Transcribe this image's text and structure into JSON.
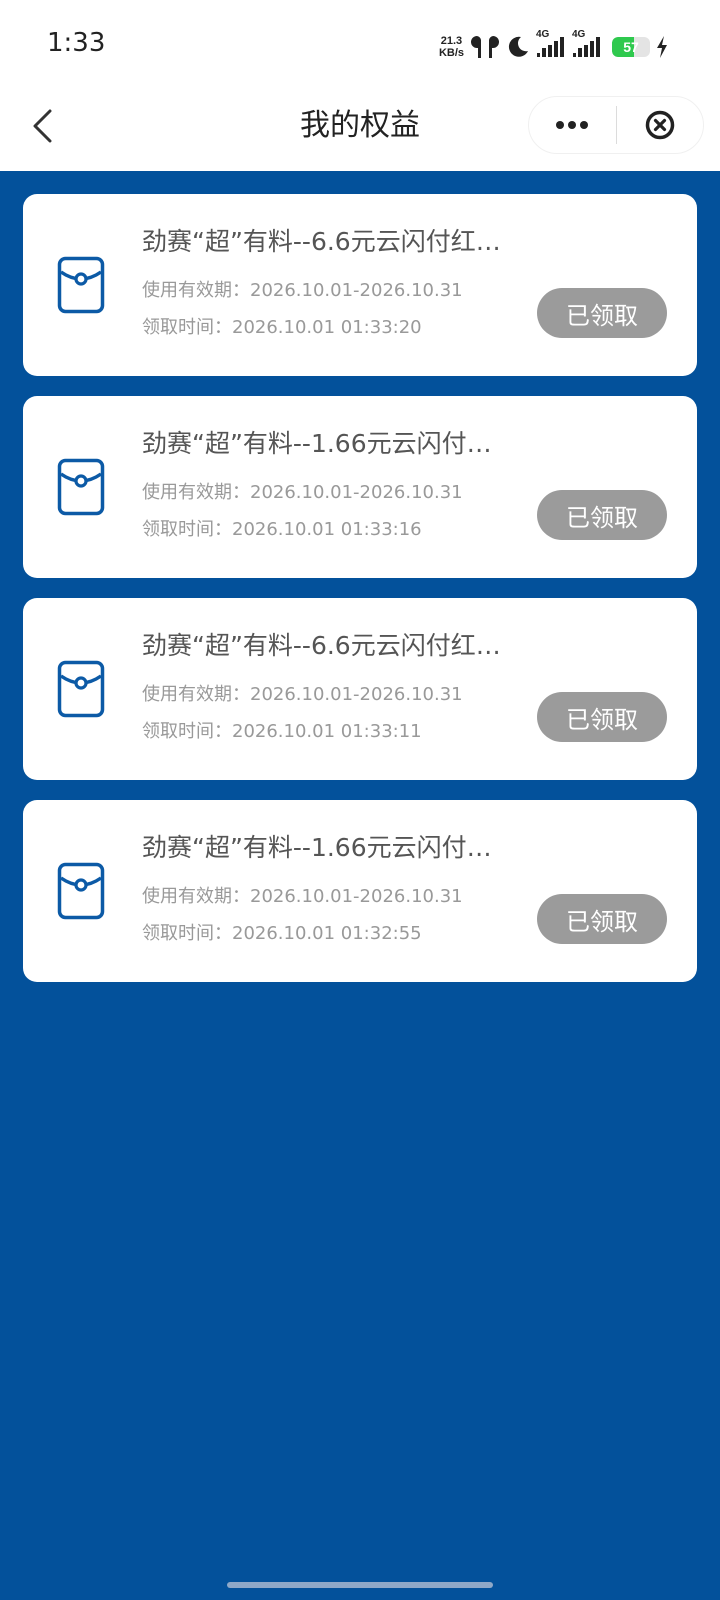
{
  "status_bar": {
    "time": "1:33",
    "net_speed_value": "21.3",
    "net_speed_unit": "KB/s",
    "signal1_label": "4G",
    "signal2_label": "4G",
    "battery_level": "57",
    "icons": [
      "earbuds-icon",
      "moon-icon",
      "signal-icon",
      "battery-icon",
      "charging-icon"
    ]
  },
  "nav": {
    "title": "我的权益",
    "back_icon": "chevron-left-icon",
    "more_icon": "more-dots-icon",
    "close_icon": "close-circle-icon"
  },
  "benefits": [
    {
      "title": "劲赛“超”有料--6.6元云闪付红…",
      "validity_label": "使用有效期：",
      "validity": "2026.10.01-2026.10.31",
      "claimed_label": "领取时间：",
      "claimed_time": "2026.10.01 01:33:20",
      "status": "已领取"
    },
    {
      "title": "劲赛“超”有料--1.66元云闪付…",
      "validity_label": "使用有效期：",
      "validity": "2026.10.01-2026.10.31",
      "claimed_label": "领取时间：",
      "claimed_time": "2026.10.01 01:33:16",
      "status": "已领取"
    },
    {
      "title": "劲赛“超”有料--6.6元云闪付红…",
      "validity_label": "使用有效期：",
      "validity": "2026.10.01-2026.10.31",
      "claimed_label": "领取时间：",
      "claimed_time": "2026.10.01 01:33:11",
      "status": "已领取"
    },
    {
      "title": "劲赛“超”有料--1.66元云闪付…",
      "validity_label": "使用有效期：",
      "validity": "2026.10.01-2026.10.31",
      "claimed_label": "领取时间：",
      "claimed_time": "2026.10.01 01:32:55",
      "status": "已领取"
    }
  ],
  "colors": {
    "background": "#03519b",
    "icon_blue": "#0c5aa6",
    "claimed_button": "#9b9b9b",
    "battery_green": "#2fc94e"
  }
}
